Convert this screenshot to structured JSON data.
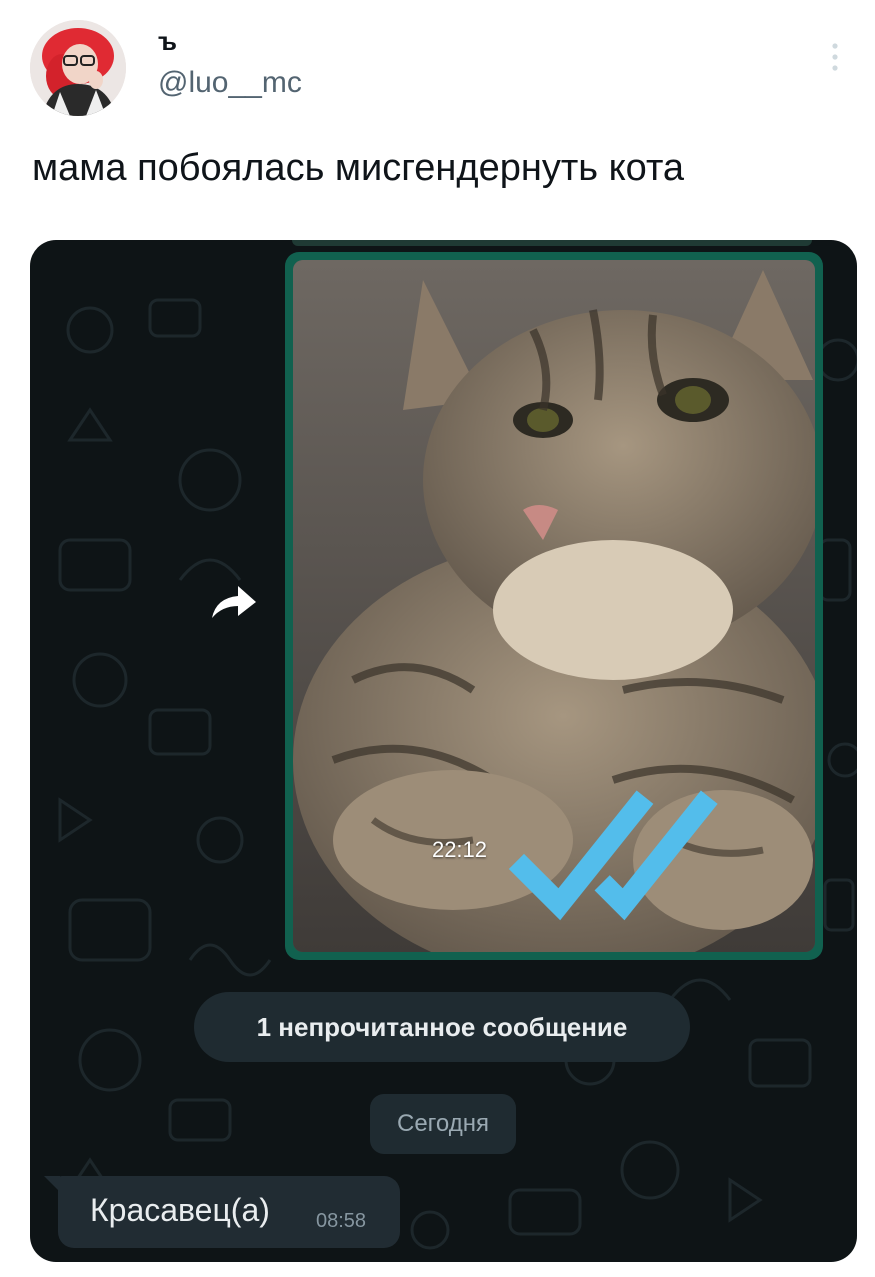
{
  "author": {
    "display_name": "ъ",
    "handle": "@luo__mc",
    "avatar_icon": "user-avatar"
  },
  "menu_icon": "more-vertical-icon",
  "tweet": {
    "text": "мама побоялась мисгендернуть кота"
  },
  "chat": {
    "photo_message": {
      "time": "22:12",
      "status_icon": "double-check-icon",
      "description": "tabby-cat-photo"
    },
    "forward_icon": "forward-arrow-icon",
    "unread_banner": "1 непрочитанное сообщение",
    "date_separator": "Сегодня",
    "incoming_message": {
      "text": "Красавец(а)",
      "time": "08:58"
    },
    "colors": {
      "background": "#0e1416",
      "outgoing_bubble": "#11614f",
      "incoming_bubble": "#212c33",
      "pill": "#1f2b31",
      "ticks": "#53bdeb"
    }
  }
}
